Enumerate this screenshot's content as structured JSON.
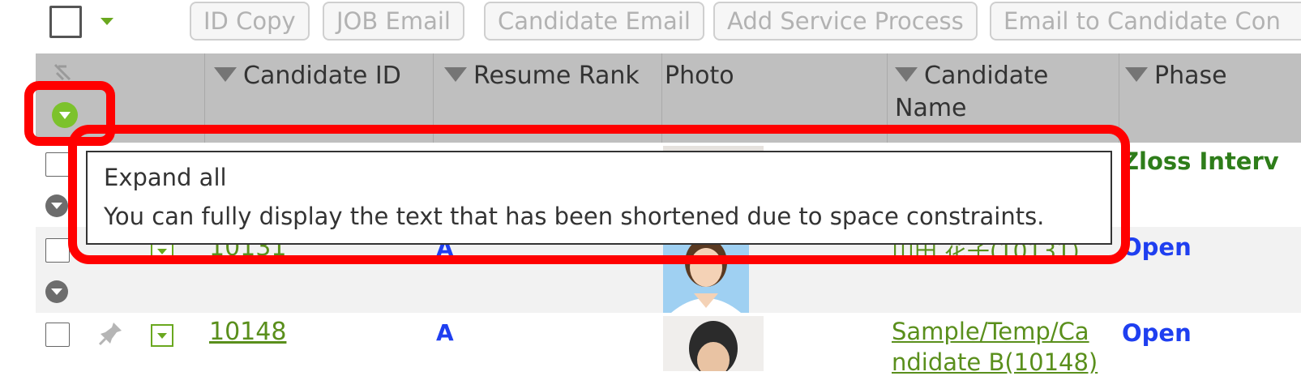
{
  "toolbar": {
    "buttons": [
      "ID Copy",
      "JOB Email",
      "Candidate Email",
      "Add Service Process",
      "Email to Candidate Con"
    ]
  },
  "table": {
    "columns": [
      "Candidate ID",
      "Resume Rank",
      "Photo",
      "Candidate",
      "Name",
      "Phase"
    ],
    "rows": [
      {
        "id": "",
        "rank": "",
        "name": "",
        "phase": "Zloss Interv",
        "phase_color": "#2e7d1a"
      },
      {
        "id": "10131",
        "rank": "A",
        "name": "山田 花子(10131)",
        "phase": "Open",
        "phase_color": "#1f3ff0"
      },
      {
        "id": "10148",
        "rank": "A",
        "name_line1": "Sample/Temp/Ca",
        "name_line2": "ndidate B(10148)",
        "phase": "Open",
        "phase_color": "#1f3ff0"
      }
    ]
  },
  "tooltip": {
    "title": "Expand all",
    "body": "You can fully display the text that has been shortened due to space constraints."
  },
  "colors": {
    "highlight": "#ff0000",
    "header_bg": "#bfbfbf",
    "link_green": "#5a8f1c",
    "accent_green": "#6aa81f"
  }
}
